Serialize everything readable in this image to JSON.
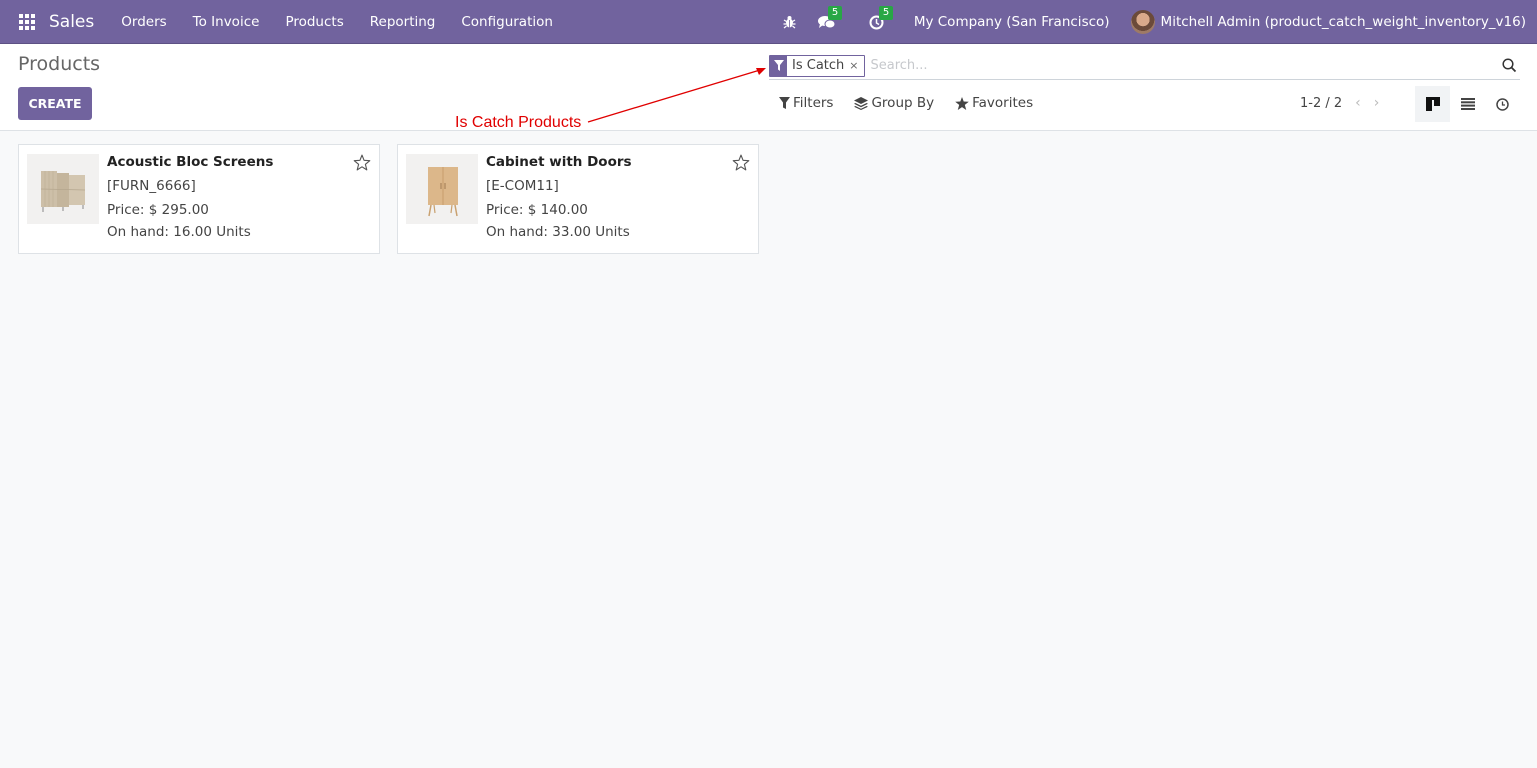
{
  "navbar": {
    "app_name": "Sales",
    "menu": [
      "Orders",
      "To Invoice",
      "Products",
      "Reporting",
      "Configuration"
    ],
    "messages_count": "5",
    "activities_count": "5",
    "company": "My Company (San Francisco)",
    "user": "Mitchell Admin (product_catch_weight_inventory_v16)"
  },
  "control_panel": {
    "title": "Products",
    "create_label": "CREATE",
    "search": {
      "facet_value": "Is Catch",
      "facet_remove": "×",
      "placeholder": "Search..."
    },
    "options": {
      "filters": "Filters",
      "group_by": "Group By",
      "favorites": "Favorites"
    },
    "pager": "1-2 / 2",
    "views": [
      "kanban",
      "list",
      "activity"
    ],
    "active_view": "kanban"
  },
  "annotation": {
    "text": "Is Catch Products",
    "color": "#e00000"
  },
  "products": [
    {
      "name": "Acoustic Bloc Screens",
      "code": "[FURN_6666]",
      "price": "Price: $ 295.00",
      "on_hand": "On hand: 16.00 Units",
      "image": "acoustic-screen-image"
    },
    {
      "name": "Cabinet with Doors",
      "code": "[E-COM11]",
      "price": "Price: $ 140.00",
      "on_hand": "On hand: 33.00 Units",
      "image": "cabinet-image"
    }
  ],
  "colors": {
    "brand": "#71639e",
    "badge": "#28a745"
  }
}
